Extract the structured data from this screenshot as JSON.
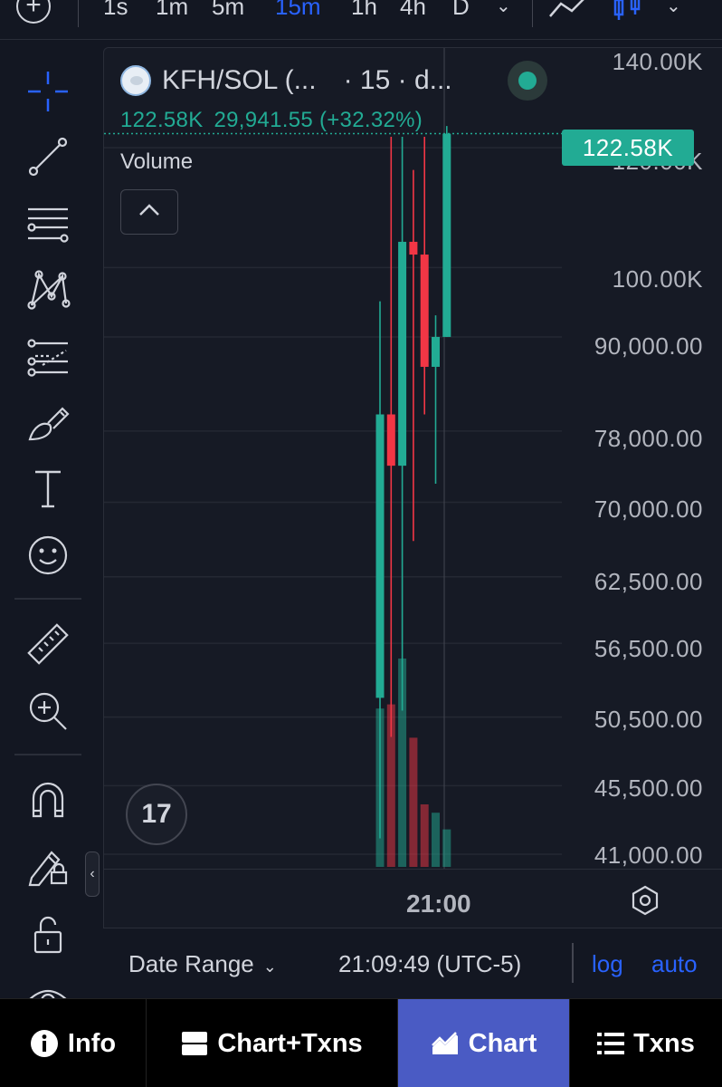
{
  "interval_bar": {
    "add_icon": "plus-circle-icon",
    "intervals": [
      "1s",
      "1m",
      "5m",
      "15m",
      "1h",
      "4h",
      "D"
    ],
    "active_interval": "15m",
    "chart_style_icons": [
      "line-chart-icon",
      "candles-icon"
    ]
  },
  "legend": {
    "symbol": "KFH/SOL (...",
    "timeframe": "· 15 · d...",
    "ohlc": [
      "122.58K",
      "29,941.55 (+32.32%)"
    ],
    "volume_label": "Volume",
    "up_color": "#22ab94",
    "down_color": "#f23645"
  },
  "price_axis": {
    "labels": [
      "140.00K",
      "120.00K",
      "100.00K",
      "90,000.00",
      "78,000.00",
      "70,000.00",
      "62,500.00",
      "56,500.00",
      "50,500.00",
      "45,500.00",
      "41,000.00"
    ],
    "last_price": "122.58K",
    "scale": "log"
  },
  "time_axis": {
    "label": "21:00"
  },
  "range_bar": {
    "date_range": "Date Range",
    "clock": "21:09:49 (UTC-5)",
    "log": "log",
    "auto": "auto"
  },
  "bottom_nav": {
    "tabs": [
      {
        "label": "Info",
        "icon": "info-icon"
      },
      {
        "label": "Chart+Txns",
        "icon": "split-view-icon"
      },
      {
        "label": "Chart",
        "icon": "area-chart-icon"
      },
      {
        "label": "Txns",
        "icon": "list-icon"
      }
    ],
    "active": "Chart"
  },
  "chart_data": {
    "type": "candlestick",
    "x_label": "21:00",
    "y_scale": "log",
    "candles": [
      {
        "open": 52000,
        "high": 95000,
        "low": 42000,
        "close": 80000,
        "dir": "up",
        "volume": 0.38
      },
      {
        "open": 80000,
        "high": 122000,
        "low": 49000,
        "close": 74000,
        "dir": "down",
        "volume": 0.39
      },
      {
        "open": 74000,
        "high": 122000,
        "low": 51000,
        "close": 104000,
        "dir": "up",
        "volume": 0.5
      },
      {
        "open": 104000,
        "high": 116000,
        "low": 66000,
        "close": 102000,
        "dir": "down",
        "volume": 0.31
      },
      {
        "open": 102000,
        "high": 122000,
        "low": 80000,
        "close": 86000,
        "dir": "down",
        "volume": 0.15
      },
      {
        "open": 86000,
        "high": 93000,
        "low": 72000,
        "close": 90000,
        "dir": "up",
        "volume": 0.13
      },
      {
        "open": 90000,
        "high": 124000,
        "low": 90000,
        "close": 122580,
        "dir": "up",
        "volume": 0.09
      }
    ]
  }
}
